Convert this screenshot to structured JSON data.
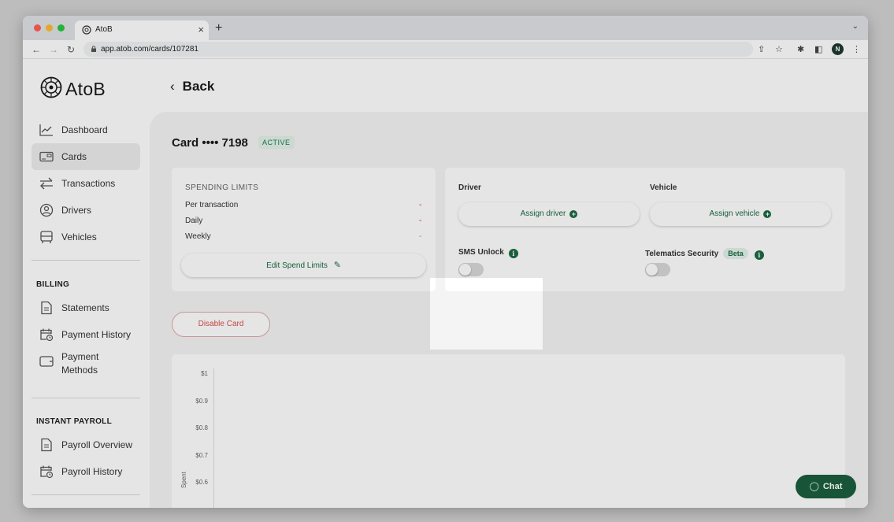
{
  "browser": {
    "tab_title": "AtoB",
    "new_tab": "+",
    "tab_close": "×",
    "url": "app.atob.com/cards/107281",
    "profile_initial": "N",
    "traffic_colors": [
      "#ff5f57",
      "#febc2e",
      "#28c840"
    ]
  },
  "app": {
    "logo": "AtoB",
    "back_label": "Back"
  },
  "sidebar": {
    "items": [
      {
        "label": "Dashboard",
        "icon": "chart-line-icon"
      },
      {
        "label": "Cards",
        "icon": "card-icon"
      },
      {
        "label": "Transactions",
        "icon": "arrows-icon"
      },
      {
        "label": "Drivers",
        "icon": "user-icon"
      },
      {
        "label": "Vehicles",
        "icon": "truck-icon"
      }
    ],
    "billing_heading": "BILLING",
    "billing_items": [
      {
        "label": "Statements",
        "icon": "document-icon"
      },
      {
        "label": "Payment History",
        "icon": "calendar-clock-icon"
      },
      {
        "label": "Payment Methods",
        "icon": "wallet-icon"
      }
    ],
    "payroll_heading": "INSTANT PAYROLL",
    "payroll_items": [
      {
        "label": "Payroll Overview",
        "icon": "document-icon"
      },
      {
        "label": "Payroll History",
        "icon": "calendar-clock-icon"
      }
    ]
  },
  "card": {
    "title": "Card •••• 7198",
    "status": "ACTIVE"
  },
  "spending": {
    "heading": "SPENDING LIMITS",
    "rows": [
      {
        "label": "Per transaction",
        "value": "-"
      },
      {
        "label": "Daily",
        "value": "-"
      },
      {
        "label": "Weekly",
        "value": "-"
      }
    ],
    "edit_button": "Edit Spend Limits"
  },
  "assign": {
    "driver_label": "Driver",
    "driver_button": "Assign driver",
    "vehicle_label": "Vehicle",
    "vehicle_button": "Assign vehicle",
    "sms_label": "SMS Unlock",
    "telematics_label": "Telematics Security",
    "beta": "Beta"
  },
  "disable_button": "Disable Card",
  "chart": {
    "ticks": [
      "$1",
      "$0.9",
      "$0.8",
      "$0.7",
      "$0.6"
    ],
    "ylabel": "Spent"
  },
  "chat_button": "Chat"
}
